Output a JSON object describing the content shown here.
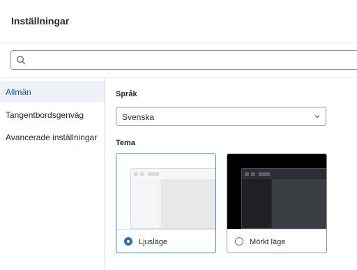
{
  "dialog": {
    "title": "Inställningar"
  },
  "search": {
    "value": "",
    "placeholder": ""
  },
  "sidebar": {
    "items": [
      {
        "label": "Allmän",
        "active": true
      },
      {
        "label": "Tangentbordsgenväg",
        "active": false
      },
      {
        "label": "Avancerade inställningar",
        "active": false
      }
    ]
  },
  "general": {
    "language_label": "Språk",
    "language_value": "Svenska",
    "theme_label": "Tema",
    "themes": [
      {
        "label": "Ljusläge",
        "selected": true
      },
      {
        "label": "Mörkt läge",
        "selected": false
      }
    ]
  },
  "colors": {
    "accent": "#2a6fb4",
    "active_nav_text": "#0b5cad",
    "active_nav_bg": "#eef2f6"
  },
  "icons": {
    "search": "search-icon",
    "dropdown": "chevron-down-icon"
  }
}
